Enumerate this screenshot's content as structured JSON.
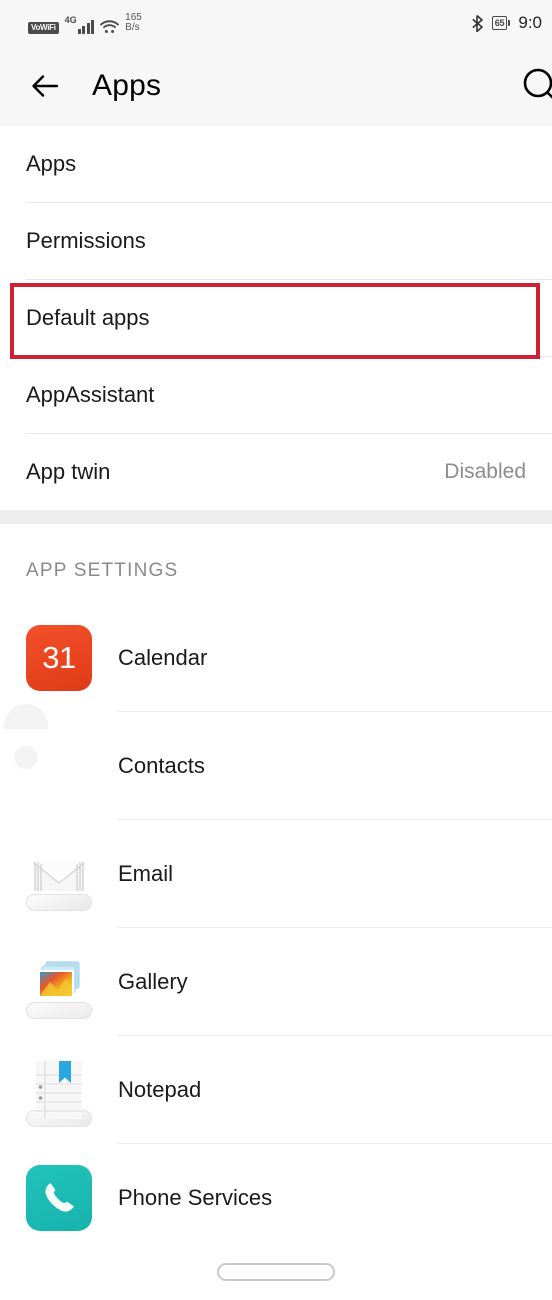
{
  "status_bar": {
    "vowifi_label": "VoWiFi",
    "network_type": "4G",
    "signal_icon": "signal-bars-icon",
    "wifi_icon": "wifi-icon",
    "data_speed_value": "165",
    "data_speed_unit": "B/s",
    "bluetooth_icon": "bluetooth-icon",
    "battery_level": "65",
    "time": "9:0"
  },
  "header": {
    "back_icon": "back-arrow-icon",
    "title": "Apps",
    "search_icon": "search-icon"
  },
  "settings_menu": {
    "rows": [
      {
        "label": "Apps",
        "value": ""
      },
      {
        "label": "Permissions",
        "value": ""
      },
      {
        "label": "Default apps",
        "value": "",
        "highlighted": true
      },
      {
        "label": "AppAssistant",
        "value": ""
      },
      {
        "label": "App twin",
        "value": "Disabled"
      }
    ]
  },
  "app_settings": {
    "section_title": "APP SETTINGS",
    "apps": [
      {
        "name": "Calendar",
        "icon": "calendar-icon",
        "icon_text": "31",
        "color": "#e8401b"
      },
      {
        "name": "Contacts",
        "icon": "contacts-icon",
        "color": "#f5952a"
      },
      {
        "name": "Email",
        "icon": "email-icon",
        "color": "#ededef"
      },
      {
        "name": "Gallery",
        "icon": "gallery-icon",
        "color": "#f0f0f2"
      },
      {
        "name": "Notepad",
        "icon": "notepad-icon",
        "color": "#eeeef0"
      },
      {
        "name": "Phone Services",
        "icon": "phone-icon",
        "color": "#1bb8b2"
      }
    ]
  },
  "nav_bar": {
    "home_pill": "home-gesture-pill"
  },
  "annotation": {
    "highlight_color": "#cc2233",
    "target": "Default apps"
  }
}
